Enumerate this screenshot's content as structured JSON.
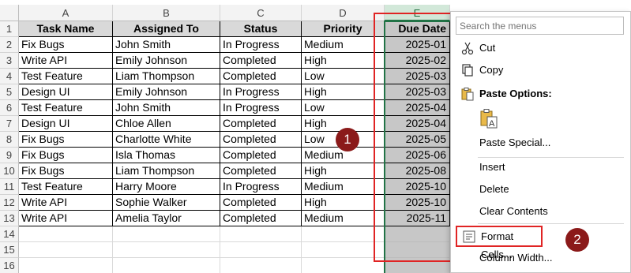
{
  "columns": [
    "A",
    "B",
    "C",
    "D",
    "E"
  ],
  "rows": [
    "1",
    "2",
    "3",
    "4",
    "5",
    "6",
    "7",
    "8",
    "9",
    "10",
    "11",
    "12",
    "13",
    "14",
    "15",
    "16"
  ],
  "table": {
    "headers": [
      "Task Name",
      "Assigned To",
      "Status",
      "Priority",
      "Due Date"
    ],
    "data": [
      [
        "Fix Bugs",
        "John Smith",
        "In Progress",
        "Medium",
        "2025-01"
      ],
      [
        "Write API",
        "Emily Johnson",
        "Completed",
        "High",
        "2025-02"
      ],
      [
        "Test Feature",
        "Liam Thompson",
        "Completed",
        "Low",
        "2025-03"
      ],
      [
        "Design UI",
        "Emily Johnson",
        "In Progress",
        "High",
        "2025-03"
      ],
      [
        "Test Feature",
        "John Smith",
        "In Progress",
        "Low",
        "2025-04"
      ],
      [
        "Design UI",
        "Chloe Allen",
        "Completed",
        "High",
        "2025-04"
      ],
      [
        "Fix Bugs",
        "Charlotte White",
        "Completed",
        "Low",
        "2025-05"
      ],
      [
        "Fix Bugs",
        "Isla Thomas",
        "Completed",
        "Medium",
        "2025-06"
      ],
      [
        "Fix Bugs",
        "Liam Thompson",
        "Completed",
        "High",
        "2025-08"
      ],
      [
        "Test Feature",
        "Harry Moore",
        "In Progress",
        "Medium",
        "2025-10"
      ],
      [
        "Write API",
        "Sophie Walker",
        "Completed",
        "High",
        "2025-10"
      ],
      [
        "Write API",
        "Amelia Taylor",
        "Completed",
        "Medium",
        "2025-11"
      ]
    ]
  },
  "badges": {
    "one": "1",
    "two": "2"
  },
  "menu": {
    "search_placeholder": "Search the menus",
    "cut": "Cut",
    "copy": "Copy",
    "paste_options": "Paste Options:",
    "paste_special": "Paste Special...",
    "insert": "Insert",
    "delete": "Delete",
    "clear_contents": "Clear Contents",
    "format_cells": "Format Cells...",
    "column_width": "Column Width..."
  },
  "colors": {
    "selection_green": "#217346",
    "highlight_red": "#e02424",
    "badge": "#8b1a1a"
  }
}
